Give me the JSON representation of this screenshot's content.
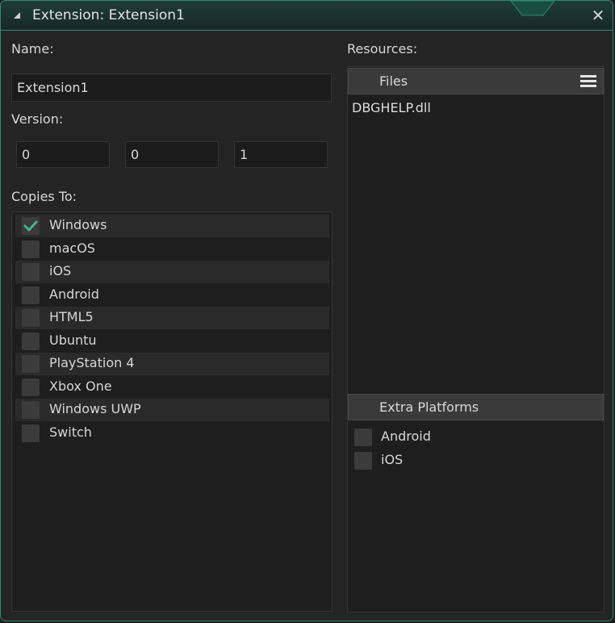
{
  "window": {
    "title": "Extension: Extension1"
  },
  "name_section": {
    "label": "Name:",
    "value": "Extension1"
  },
  "version_section": {
    "label": "Version:",
    "values": [
      "0",
      "0",
      "1"
    ]
  },
  "copies_to": {
    "label": "Copies To:",
    "platforms": [
      {
        "label": "Windows",
        "checked": true
      },
      {
        "label": "macOS",
        "checked": false
      },
      {
        "label": "iOS",
        "checked": false
      },
      {
        "label": "Android",
        "checked": false
      },
      {
        "label": "HTML5",
        "checked": false
      },
      {
        "label": "Ubuntu",
        "checked": false
      },
      {
        "label": "PlayStation 4",
        "checked": false
      },
      {
        "label": "Xbox One",
        "checked": false
      },
      {
        "label": "Windows UWP",
        "checked": false
      },
      {
        "label": "Switch",
        "checked": false
      }
    ]
  },
  "resources": {
    "label": "Resources:",
    "files_header": "Files",
    "files": [
      "DBGHELP.dll"
    ],
    "extra_platforms_header": "Extra Platforms",
    "extra_platforms": [
      {
        "label": "Android",
        "checked": false
      },
      {
        "label": "iOS",
        "checked": false
      }
    ]
  },
  "colors": {
    "accent": "#2f8a6f",
    "check": "#3fb58a"
  }
}
